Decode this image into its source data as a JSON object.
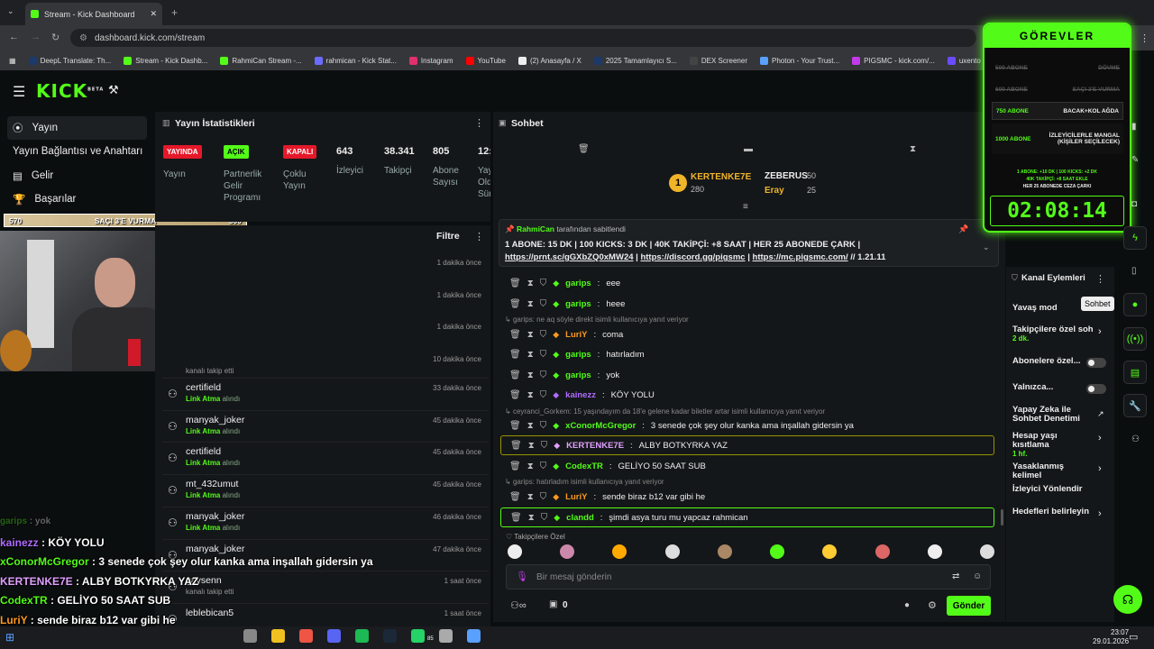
{
  "browser": {
    "tab_title": "Stream - Kick Dashboard",
    "url": "dashboard.kick.com/stream",
    "bookmarks": [
      "DeepL Translate: Th...",
      "Stream - Kick Dashb...",
      "RahmiCan Stream -...",
      "rahmican - Kick Stat...",
      "Instagram",
      "YouTube",
      "(2) Anasayfa / X",
      "2025 Tamamlayıcı S...",
      "DEX Screener",
      "Photon - Your Trust...",
      "PIGSMC - kick.com/...",
      "uxento"
    ]
  },
  "kick": {
    "logo": "KICK",
    "beta": "BETA"
  },
  "sidebar": {
    "items": [
      "Yayın",
      "Yayın Bağlantısı ve Anahtarı",
      "Gelir",
      "Başarılar"
    ]
  },
  "stats": {
    "title": "Yayın İstatistikleri",
    "badges": [
      "YAYINDA",
      "AÇIK",
      "KAPALI"
    ],
    "labels": [
      "Yayın",
      "Partnerlik Gelir Programı",
      "Çoklu Yayın"
    ],
    "numbers": [
      "643",
      "38.341",
      "805",
      "12:"
    ],
    "num_labels": [
      "İzleyici",
      "Takipçi",
      "Abone Sayısı",
      "Yay Old Sür"
    ]
  },
  "activity": {
    "filter": "Filtre",
    "times_top": [
      "1 dakika önce",
      "1 dakika önce",
      "1 dakika önce",
      "10 dakika önce"
    ],
    "partial": "kanalı takip etti",
    "rows": [
      {
        "user": "certifield",
        "sub1": "Link Atma",
        "sub2": "alındı",
        "time": "33 dakika önce"
      },
      {
        "user": "manyak_joker",
        "sub1": "Link Atma",
        "sub2": "alındı",
        "time": "45 dakika önce"
      },
      {
        "user": "certifield",
        "sub1": "Link Atma",
        "sub2": "alındı",
        "time": "45 dakika önce"
      },
      {
        "user": "mt_432umut",
        "sub1": "Link Atma",
        "sub2": "alındı",
        "time": "45 dakika önce"
      },
      {
        "user": "manyak_joker",
        "sub1": "Link Atma",
        "sub2": "alındı",
        "time": "46 dakika önce"
      },
      {
        "user": "manyak_joker",
        "sub1": "",
        "sub2": "",
        "time": "47 dakika önce"
      },
      {
        "user": "gaysenn",
        "sub1": "",
        "sub2": "kanalı takip etti",
        "time": "1 saat önce"
      },
      {
        "user": "leblebican5",
        "sub1": "",
        "sub2": "",
        "time": "1 saat önce"
      }
    ]
  },
  "chat": {
    "title": "Sohbet",
    "top": [
      {
        "name": "KERTENKE7E",
        "val": "280"
      },
      {
        "name": "ZEBERUS",
        "val": "50"
      },
      {
        "name": "Eray",
        "val": "25"
      }
    ],
    "pinned_by": "RahmiCan",
    "pinned_suffix": "tarafından sabitlendi",
    "pinned_text": "1 ABONE: 15 DK | 100 KICKS: 3 DK | 40K TAKİPÇİ: +8 SAAT | HER 25 ABONEDE ÇARK |",
    "pinned_links": [
      "https://prnt.sc/gGXbZQ0xMW24",
      "https://discord.gg/pigsmc",
      "https://mc.pigsmc.com/"
    ],
    "pinned_ver": "// 1.21.11",
    "messages": [
      {
        "user": "garips",
        "text": "eee",
        "color": "#53fc18"
      },
      {
        "user": "garips",
        "text": "heee",
        "color": "#53fc18"
      },
      {
        "user": "LuriY",
        "text": "coma",
        "color": "#ff9a1f",
        "reply": "garips: ne aq söyle direkt isimli kullanıcıya yanıt veriyor"
      },
      {
        "user": "garips",
        "text": "hatırladım",
        "color": "#53fc18"
      },
      {
        "user": "garips",
        "text": "yok",
        "color": "#53fc18"
      },
      {
        "user": "kainezz",
        "text": "KÖY YOLU",
        "color": "#b06cff"
      },
      {
        "user": "xConorMcGregor",
        "text": "3 senede çok şey olur kanka ama inşallah gidersin ya",
        "color": "#53fc18",
        "reply": "ceyranci_Gorkem: 15 yaşındayım da 18'e gelene kadar biletler artar isimli kullanıcıya yanıt veriyor"
      },
      {
        "user": "KERTENKE7E",
        "text": "ALBY BOTKYRKA YAZ",
        "color": "#e0a0ff"
      },
      {
        "user": "CodexTR",
        "text": "GELİYO 50 SAAT SUB",
        "color": "#53fc18"
      },
      {
        "user": "LuriY",
        "text": "sende biraz b12 var gibi he",
        "color": "#ff9a1f",
        "reply": "garips: hatırladım isimli kullanıcıya yanıt veriyor"
      },
      {
        "user": "clandd",
        "text": "şimdi asya turu mu yapcaz rahmican",
        "color": "#53fc18"
      }
    ],
    "emote_label": "Takipçilere Özel",
    "input_placeholder": "Bir mesaj gönderin",
    "send": "Gönder",
    "count": "0"
  },
  "gorevler": {
    "title": "GÖREVLER",
    "rows": [
      {
        "l": "500 ABONE",
        "r": "DÖVME",
        "done": true
      },
      {
        "l": "600 ABONE",
        "r": "SAÇI 3'E VURMA",
        "done": true
      },
      {
        "l": "750 ABONE",
        "r": "BACAK+KOL AĞDA",
        "done": false,
        "active": true
      },
      {
        "l": "1000 ABONE",
        "r": "İZLEYİCİLERLE MANGAL (KİŞİLER SEÇİLECEK)",
        "done": false
      }
    ],
    "rules": [
      "1 ABONE: +10 DK | 100 KICKS: +2 DK",
      "40K TAKİPÇİ: +8 SAAT EKLE",
      "HER 25 ABONEDE CEZA ÇARKI"
    ],
    "timer": "02:08:14"
  },
  "progress": {
    "left": "570",
    "label": "SAÇI 3'E VURMA",
    "right": "500"
  },
  "kanal": {
    "title": "Kanal Eylemleri",
    "tooltip": "Sohbet",
    "items": [
      {
        "label": "Yavaş mod"
      },
      {
        "label": "Takipçilere özel soh",
        "sub": "2 dk."
      },
      {
        "label": "Abonelere özel..."
      },
      {
        "label": "Yalnızca..."
      },
      {
        "label": "Yapay Zeka ile Sohbet Denetimi"
      },
      {
        "label": "Hesap yaşı kısıtlama",
        "sub": "1 hf."
      },
      {
        "label": "Yasaklanmış kelimel"
      },
      {
        "label": "İzleyici Yönlendir"
      },
      {
        "label": "Hedefleri belirleyin"
      }
    ]
  },
  "overlay": [
    {
      "u": "garips",
      "t": "yok",
      "c": "#53fc18"
    },
    {
      "u": "kainezz",
      "t": "KÖY YOLU",
      "c": "#b06cff"
    },
    {
      "u": "xConorMcGregor",
      "t": "3 senede çok şey olur kanka ama inşallah gidersin ya",
      "c": "#53fc18"
    },
    {
      "u": "KERTENKE7E",
      "t": "ALBY BOTKYRKA YAZ",
      "c": "#e0a0ff"
    },
    {
      "u": "CodexTR",
      "t": "GELİYO 50 SAAT SUB",
      "c": "#53fc18"
    },
    {
      "u": "LuriY",
      "t": "sende biraz b12 var gibi he",
      "c": "#ff9a1f"
    },
    {
      "u": "clandd",
      "t": "şimdi asya turu mu yapcaz rahmican",
      "c": "#53fc18"
    }
  ],
  "taskbar": {
    "time": "23:07",
    "date": "29.01.2026",
    "badge": "85"
  }
}
